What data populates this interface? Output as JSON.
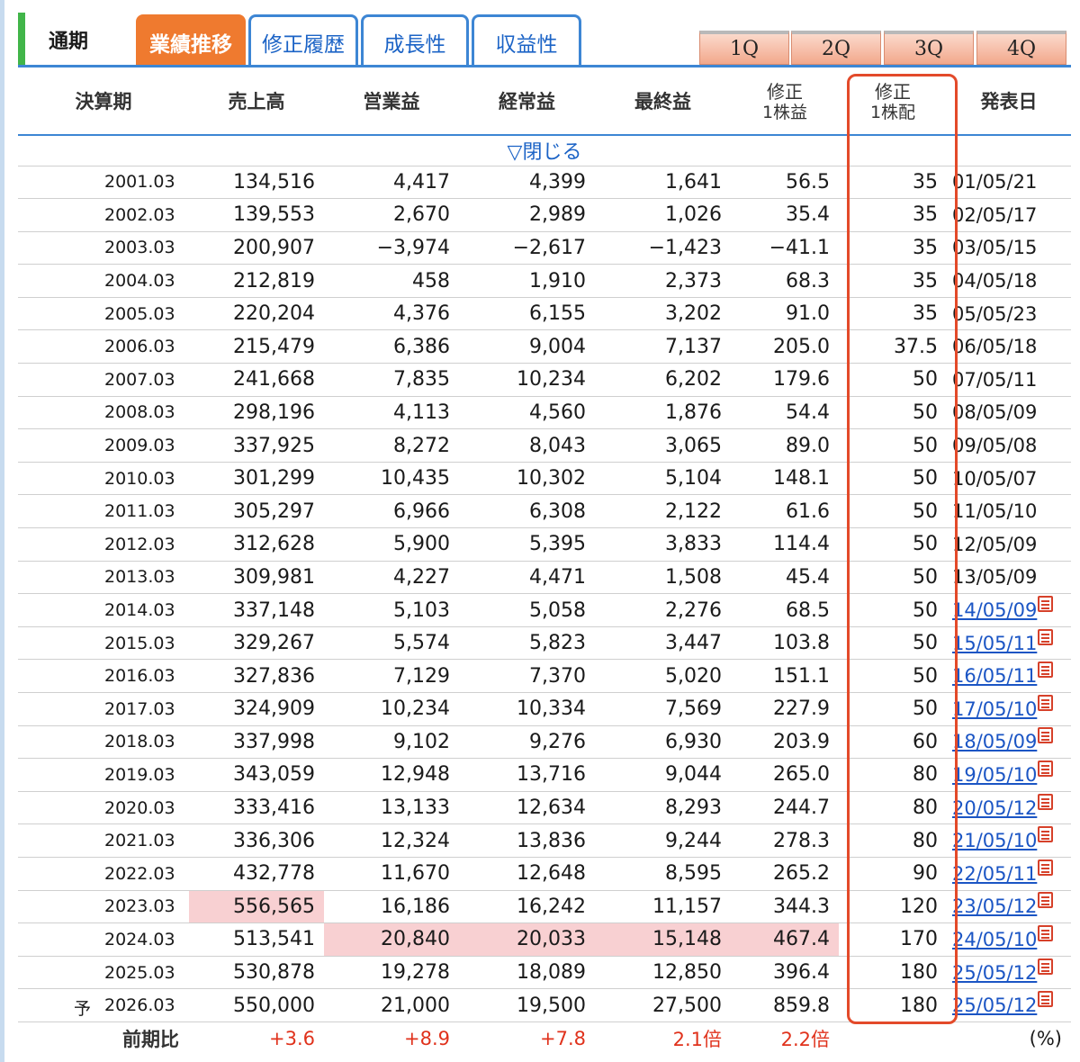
{
  "tabs": {
    "current": "通期",
    "items": [
      {
        "label": "業績推移",
        "active": true
      },
      {
        "label": "修正履歴",
        "active": false
      },
      {
        "label": "成長性",
        "active": false
      },
      {
        "label": "収益性",
        "active": false
      }
    ],
    "quarters": [
      "1Q",
      "2Q",
      "3Q",
      "4Q"
    ]
  },
  "table": {
    "headers": {
      "period": "決算期",
      "sales": "売上高",
      "operating": "営業益",
      "ordinary": "経常益",
      "net": "最終益",
      "eps_top": "修正",
      "eps_bottom": "1株益",
      "div_top": "修正",
      "div_bottom": "1株配",
      "date": "発表日"
    },
    "toggle": "▽閉じる",
    "rows": [
      {
        "period": "2001.03",
        "sales": "134,516",
        "op": "4,417",
        "ord": "4,399",
        "net": "1,641",
        "eps": "56.5",
        "div": "35",
        "date": "01/05/21",
        "link": false
      },
      {
        "period": "2002.03",
        "sales": "139,553",
        "op": "2,670",
        "ord": "2,989",
        "net": "1,026",
        "eps": "35.4",
        "div": "35",
        "date": "02/05/17",
        "link": false
      },
      {
        "period": "2003.03",
        "sales": "200,907",
        "op": "−3,974",
        "ord": "−2,617",
        "net": "−1,423",
        "eps": "−41.1",
        "div": "35",
        "date": "03/05/15",
        "link": false
      },
      {
        "period": "2004.03",
        "sales": "212,819",
        "op": "458",
        "ord": "1,910",
        "net": "2,373",
        "eps": "68.3",
        "div": "35",
        "date": "04/05/18",
        "link": false
      },
      {
        "period": "2005.03",
        "sales": "220,204",
        "op": "4,376",
        "ord": "6,155",
        "net": "3,202",
        "eps": "91.0",
        "div": "35",
        "date": "05/05/23",
        "link": false
      },
      {
        "period": "2006.03",
        "sales": "215,479",
        "op": "6,386",
        "ord": "9,004",
        "net": "7,137",
        "eps": "205.0",
        "div": "37.5",
        "date": "06/05/18",
        "link": false
      },
      {
        "period": "2007.03",
        "sales": "241,668",
        "op": "7,835",
        "ord": "10,234",
        "net": "6,202",
        "eps": "179.6",
        "div": "50",
        "date": "07/05/11",
        "link": false
      },
      {
        "period": "2008.03",
        "sales": "298,196",
        "op": "4,113",
        "ord": "4,560",
        "net": "1,876",
        "eps": "54.4",
        "div": "50",
        "date": "08/05/09",
        "link": false
      },
      {
        "period": "2009.03",
        "sales": "337,925",
        "op": "8,272",
        "ord": "8,043",
        "net": "3,065",
        "eps": "89.0",
        "div": "50",
        "date": "09/05/08",
        "link": false
      },
      {
        "period": "2010.03",
        "sales": "301,299",
        "op": "10,435",
        "ord": "10,302",
        "net": "5,104",
        "eps": "148.1",
        "div": "50",
        "date": "10/05/07",
        "link": false
      },
      {
        "period": "2011.03",
        "sales": "305,297",
        "op": "6,966",
        "ord": "6,308",
        "net": "2,122",
        "eps": "61.6",
        "div": "50",
        "date": "11/05/10",
        "link": false
      },
      {
        "period": "2012.03",
        "sales": "312,628",
        "op": "5,900",
        "ord": "5,395",
        "net": "3,833",
        "eps": "114.4",
        "div": "50",
        "date": "12/05/09",
        "link": false
      },
      {
        "period": "2013.03",
        "sales": "309,981",
        "op": "4,227",
        "ord": "4,471",
        "net": "1,508",
        "eps": "45.4",
        "div": "50",
        "date": "13/05/09",
        "link": false
      },
      {
        "period": "2014.03",
        "sales": "337,148",
        "op": "5,103",
        "ord": "5,058",
        "net": "2,276",
        "eps": "68.5",
        "div": "50",
        "date": "14/05/09",
        "link": true
      },
      {
        "period": "2015.03",
        "sales": "329,267",
        "op": "5,574",
        "ord": "5,823",
        "net": "3,447",
        "eps": "103.8",
        "div": "50",
        "date": "15/05/11",
        "link": true
      },
      {
        "period": "2016.03",
        "sales": "327,836",
        "op": "7,129",
        "ord": "7,370",
        "net": "5,020",
        "eps": "151.1",
        "div": "50",
        "date": "16/05/11",
        "link": true
      },
      {
        "period": "2017.03",
        "sales": "324,909",
        "op": "10,234",
        "ord": "10,334",
        "net": "7,569",
        "eps": "227.9",
        "div": "50",
        "date": "17/05/10",
        "link": true
      },
      {
        "period": "2018.03",
        "sales": "337,998",
        "op": "9,102",
        "ord": "9,276",
        "net": "6,930",
        "eps": "203.9",
        "div": "60",
        "date": "18/05/09",
        "link": true
      },
      {
        "period": "2019.03",
        "sales": "343,059",
        "op": "12,948",
        "ord": "13,716",
        "net": "9,044",
        "eps": "265.0",
        "div": "80",
        "date": "19/05/10",
        "link": true
      },
      {
        "period": "2020.03",
        "sales": "333,416",
        "op": "13,133",
        "ord": "12,634",
        "net": "8,293",
        "eps": "244.7",
        "div": "80",
        "date": "20/05/12",
        "link": true
      },
      {
        "period": "2021.03",
        "sales": "336,306",
        "op": "12,324",
        "ord": "13,836",
        "net": "9,244",
        "eps": "278.3",
        "div": "80",
        "date": "21/05/10",
        "link": true
      },
      {
        "period": "2022.03",
        "sales": "432,778",
        "op": "11,670",
        "ord": "12,648",
        "net": "8,595",
        "eps": "265.2",
        "div": "90",
        "date": "22/05/11",
        "link": true
      },
      {
        "period": "2023.03",
        "sales": "556,565",
        "op": "16,186",
        "ord": "16,242",
        "net": "11,157",
        "eps": "344.3",
        "div": "120",
        "date": "23/05/12",
        "link": true,
        "hl": [
          "sales"
        ]
      },
      {
        "period": "2024.03",
        "sales": "513,541",
        "op": "20,840",
        "ord": "20,033",
        "net": "15,148",
        "eps": "467.4",
        "div": "170",
        "date": "24/05/10",
        "link": true,
        "hl": [
          "op",
          "ord",
          "net",
          "eps"
        ]
      },
      {
        "period": "2025.03",
        "sales": "530,878",
        "op": "19,278",
        "ord": "18,089",
        "net": "12,850",
        "eps": "396.4",
        "div": "180",
        "date": "25/05/12",
        "link": true
      },
      {
        "period": "2026.03",
        "prefix": "予",
        "sales": "550,000",
        "op": "21,000",
        "ord": "19,500",
        "net": "27,500",
        "eps": "859.8",
        "div": "180",
        "date": "25/05/12",
        "link": true
      }
    ],
    "compare": {
      "label": "前期比",
      "sales": "+3.6",
      "op": "+8.9",
      "ord": "+7.8",
      "net": "2.1倍",
      "eps": "2.2倍",
      "unit": "(%)"
    }
  }
}
